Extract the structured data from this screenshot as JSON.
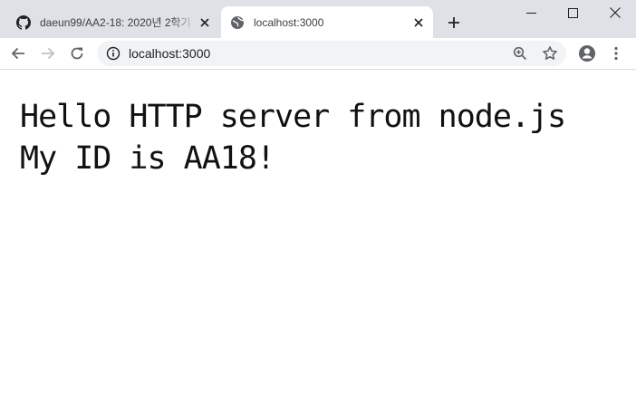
{
  "tabs": [
    {
      "title": "daeun99/AA2-18: 2020년 2학기",
      "favicon": "github-icon",
      "active": false
    },
    {
      "title": "localhost:3000",
      "favicon": "globe-icon",
      "active": true
    }
  ],
  "toolbar": {
    "url": "localhost:3000"
  },
  "content": {
    "line1": "Hello HTTP server from node.js",
    "line2": "My ID is AA18!"
  },
  "colors": {
    "tabstrip": "#dee1e6",
    "omnibox": "#f1f3f4",
    "icon": "#5f6368"
  }
}
